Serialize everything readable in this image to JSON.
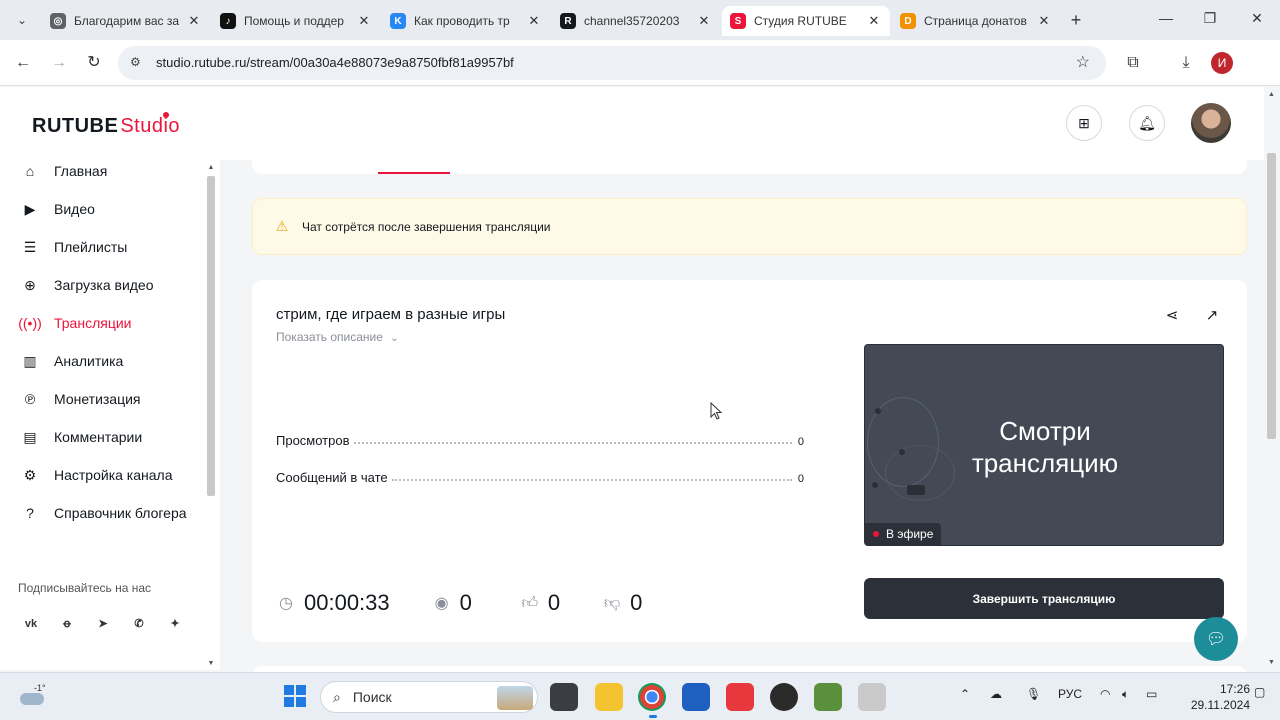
{
  "browser": {
    "tabs": [
      {
        "title": "Благодарим вас за",
        "favicon": "globe-icon",
        "color": "#5f6368"
      },
      {
        "title": "Помощь и поддер",
        "favicon": "tiktok-icon",
        "color": "#111111"
      },
      {
        "title": "Как проводить тр",
        "favicon": "vk-icon",
        "color": "#2787f5"
      },
      {
        "title": "channel35720203",
        "favicon": "rutube-icon",
        "color": "#14191f"
      },
      {
        "title": "Студия RUTUBE",
        "favicon": "rutube-studio-icon",
        "color": "#ed143b",
        "active": true
      },
      {
        "title": "Страница донатов",
        "favicon": "donation-icon",
        "color": "#f29100"
      }
    ],
    "url": "studio.rutube.ru/stream/00a30a4e88073e9a8750fbf81a9957bf",
    "profile_initial": "И"
  },
  "header": {
    "logo_main": "RUTUBE",
    "logo_sub": "Studio"
  },
  "sidebar": {
    "items": [
      {
        "label": "Главная",
        "icon": "home-icon"
      },
      {
        "label": "Видео",
        "icon": "video-icon"
      },
      {
        "label": "Плейлисты",
        "icon": "playlist-icon"
      },
      {
        "label": "Загрузка видео",
        "icon": "upload-icon"
      },
      {
        "label": "Трансляции",
        "icon": "broadcast-icon",
        "active": true
      },
      {
        "label": "Аналитика",
        "icon": "analytics-icon"
      },
      {
        "label": "Монетизация",
        "icon": "monetization-icon"
      },
      {
        "label": "Комментарии",
        "icon": "comments-icon"
      },
      {
        "label": "Настройка канала",
        "icon": "settings-icon"
      },
      {
        "label": "Справочник блогера",
        "icon": "help-icon"
      }
    ],
    "follow_label": "Подписывайтесь на нас",
    "social": [
      "vk-icon",
      "ok-icon",
      "telegram-icon",
      "viber-icon",
      "plus-icon"
    ]
  },
  "alert": {
    "text": "Чат сотрётся после завершения трансляции"
  },
  "stream": {
    "title": "стрим, где играем в разные игры",
    "show_description": "Показать описание",
    "stats": [
      {
        "label": "Просмотров",
        "value": "0"
      },
      {
        "label": "Сообщений в чате",
        "value": "0"
      }
    ],
    "preview_text_line1": "Смотри",
    "preview_text_line2": "трансляцию",
    "live_label": "В эфире",
    "duration": "00:00:33",
    "viewers": "0",
    "likes": "0",
    "dislikes": "0",
    "end_button": "Завершить трансляцию"
  },
  "taskbar": {
    "weather_temp": "-1°",
    "search_placeholder": "Поиск",
    "language": "РУС",
    "time": "17:26",
    "date": "29.11.2024"
  },
  "colors": {
    "accent": "#ed143b",
    "alert_bg": "#fff9e8",
    "button_dark": "#2c3139",
    "chat_fab": "#1e8d9a"
  }
}
